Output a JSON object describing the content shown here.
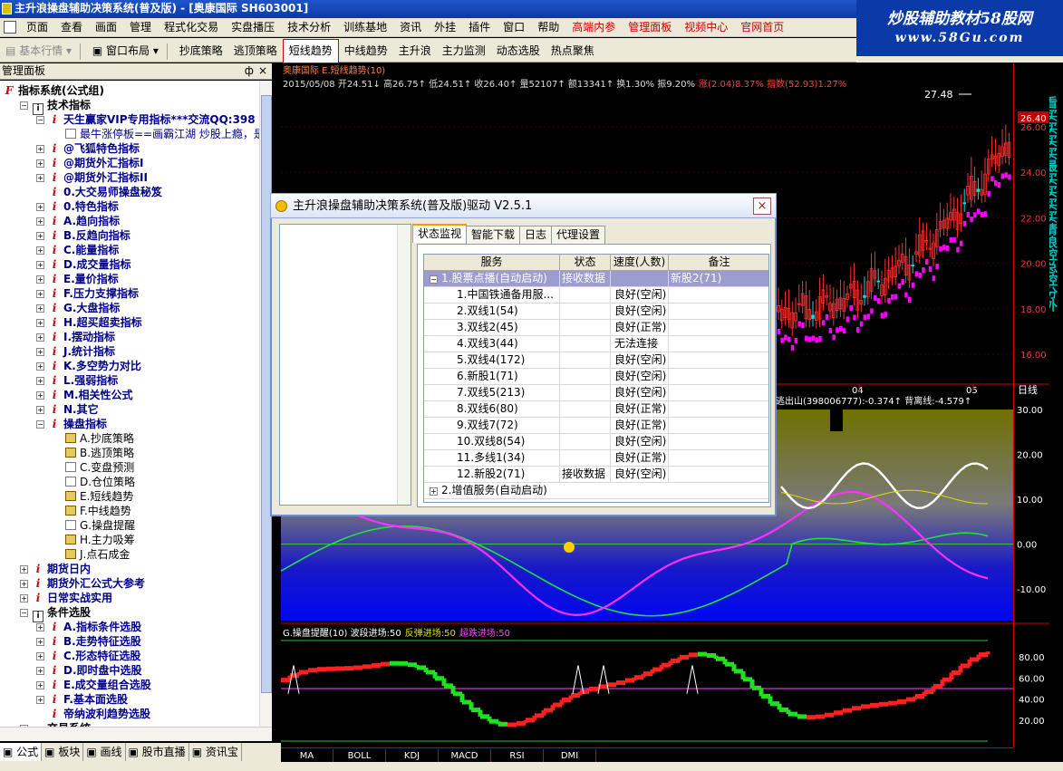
{
  "window": {
    "title": "主升浪操盘辅助决策系统(普及版) - [奥康国际 SH603001]"
  },
  "logo": {
    "line1": "炒股辅助教材58股网",
    "line2": "www.58Gu.com"
  },
  "menu": [
    "页面",
    "查看",
    "画面",
    "管理",
    "程式化交易",
    "实盘播压",
    "技术分析",
    "训练基地",
    "资讯",
    "外挂",
    "插件",
    "窗口",
    "帮助"
  ],
  "menu_red": [
    "高端内参",
    "管理面板",
    "视频中心",
    "官网首页"
  ],
  "toolbar": {
    "basic": "基本行情",
    "layout": "窗口布局",
    "items": [
      "抄底策略",
      "逃顶策略",
      "短线趋势",
      "中线趋势",
      "主升浪",
      "主力监测",
      "动态选股",
      "热点聚焦"
    ],
    "active": "短线趋势"
  },
  "panel": {
    "title": "管理面板",
    "pin": "ф",
    "close": "×"
  },
  "tree": [
    {
      "d": 0,
      "k": "f",
      "t": "指标系统(公式组)",
      "b": true
    },
    {
      "d": 1,
      "k": "pm-",
      "ic": "book",
      "t": "技术指标",
      "b": true
    },
    {
      "d": 2,
      "k": "pm-",
      "ic": "i",
      "t": "天生赢家VIP专用指标***交流QQ:398",
      "b": true,
      "c": "blue"
    },
    {
      "d": 3,
      "k": "",
      "ic": "chart",
      "t": "最牛涨停板==画霸江湖  炒股上瘾，是L",
      "c": "blue"
    },
    {
      "d": 2,
      "k": "pm+",
      "ic": "i",
      "t": "@飞狐特色指标",
      "b": true,
      "c": "blue"
    },
    {
      "d": 2,
      "k": "pm+",
      "ic": "i",
      "t": "@期货外汇指标I",
      "b": true,
      "c": "blue"
    },
    {
      "d": 2,
      "k": "pm+",
      "ic": "i",
      "t": "@期货外汇指标II",
      "b": true,
      "c": "blue"
    },
    {
      "d": 2,
      "k": "",
      "ic": "i",
      "t": "0.大交易师操盘秘笈",
      "b": true,
      "c": "blue"
    },
    {
      "d": 2,
      "k": "pm+",
      "ic": "i",
      "t": "0.特色指标",
      "b": true,
      "c": "blue"
    },
    {
      "d": 2,
      "k": "pm+",
      "ic": "i",
      "t": "A.趋向指标",
      "b": true,
      "c": "blue"
    },
    {
      "d": 2,
      "k": "pm+",
      "ic": "i",
      "t": "B.反趋向指标",
      "b": true,
      "c": "blue"
    },
    {
      "d": 2,
      "k": "pm+",
      "ic": "i",
      "t": "C.能量指标",
      "b": true,
      "c": "blue"
    },
    {
      "d": 2,
      "k": "pm+",
      "ic": "i",
      "t": "D.成交量指标",
      "b": true,
      "c": "blue"
    },
    {
      "d": 2,
      "k": "pm+",
      "ic": "i",
      "t": "E.量价指标",
      "b": true,
      "c": "blue"
    },
    {
      "d": 2,
      "k": "pm+",
      "ic": "i",
      "t": "F.压力支撑指标",
      "b": true,
      "c": "blue"
    },
    {
      "d": 2,
      "k": "pm+",
      "ic": "i",
      "t": "G.大盘指标",
      "b": true,
      "c": "blue"
    },
    {
      "d": 2,
      "k": "pm+",
      "ic": "i",
      "t": "H.超买超卖指标",
      "b": true,
      "c": "blue"
    },
    {
      "d": 2,
      "k": "pm+",
      "ic": "i",
      "t": "I.摆动指标",
      "b": true,
      "c": "blue"
    },
    {
      "d": 2,
      "k": "pm+",
      "ic": "i",
      "t": "J.统计指标",
      "b": true,
      "c": "blue"
    },
    {
      "d": 2,
      "k": "pm+",
      "ic": "i",
      "t": "K.多空势力对比",
      "b": true,
      "c": "blue"
    },
    {
      "d": 2,
      "k": "pm+",
      "ic": "i",
      "t": "L.强弱指标",
      "b": true,
      "c": "blue"
    },
    {
      "d": 2,
      "k": "pm+",
      "ic": "i",
      "t": "M.相关性公式",
      "b": true,
      "c": "blue"
    },
    {
      "d": 2,
      "k": "pm+",
      "ic": "i",
      "t": "N.其它",
      "b": true,
      "c": "blue"
    },
    {
      "d": 2,
      "k": "pm-",
      "ic": "i",
      "t": "操盘指标",
      "b": true,
      "c": "blue"
    },
    {
      "d": 3,
      "k": "",
      "ic": "y",
      "t": "A.抄底策略"
    },
    {
      "d": 3,
      "k": "",
      "ic": "y",
      "t": "B.逃顶策略"
    },
    {
      "d": 3,
      "k": "",
      "ic": "chart",
      "t": "C.变盘预测"
    },
    {
      "d": 3,
      "k": "",
      "ic": "chart",
      "t": "D.仓位策略"
    },
    {
      "d": 3,
      "k": "",
      "ic": "y",
      "t": "E.短线趋势"
    },
    {
      "d": 3,
      "k": "",
      "ic": "y",
      "t": "F.中线趋势"
    },
    {
      "d": 3,
      "k": "",
      "ic": "chart",
      "t": "G.操盘提醒"
    },
    {
      "d": 3,
      "k": "",
      "ic": "y",
      "t": "H.主力吸筹"
    },
    {
      "d": 3,
      "k": "",
      "ic": "y",
      "t": "J.点石成金"
    },
    {
      "d": 1,
      "k": "pm+",
      "ic": "i",
      "t": "期货日内",
      "b": true,
      "c": "blue"
    },
    {
      "d": 1,
      "k": "pm+",
      "ic": "i",
      "t": "期货外汇公式大参考",
      "b": true,
      "c": "blue"
    },
    {
      "d": 1,
      "k": "pm+",
      "ic": "i",
      "t": "日常实战实用",
      "b": true,
      "c": "blue"
    },
    {
      "d": 1,
      "k": "pm-",
      "ic": "book",
      "t": "条件选股",
      "b": true
    },
    {
      "d": 2,
      "k": "pm+",
      "ic": "i",
      "t": "A.指标条件选股",
      "b": true,
      "c": "blue"
    },
    {
      "d": 2,
      "k": "pm+",
      "ic": "i",
      "t": "B.走势特征选股",
      "b": true,
      "c": "blue"
    },
    {
      "d": 2,
      "k": "pm+",
      "ic": "i",
      "t": "C.形态特征选股",
      "b": true,
      "c": "blue"
    },
    {
      "d": 2,
      "k": "pm+",
      "ic": "i",
      "t": "D.即时盘中选股",
      "b": true,
      "c": "blue"
    },
    {
      "d": 2,
      "k": "pm+",
      "ic": "i",
      "t": "E.成交量组合选股",
      "b": true,
      "c": "blue"
    },
    {
      "d": 2,
      "k": "pm+",
      "ic": "i",
      "t": "F.基本面选股",
      "b": true,
      "c": "blue"
    },
    {
      "d": 2,
      "k": "",
      "ic": "i",
      "t": "帝纳波利趋势选股",
      "b": true,
      "c": "blue"
    },
    {
      "d": 1,
      "k": "pm+",
      "ic": "book",
      "t": "交易系统",
      "b": true
    }
  ],
  "bottom_tabs": [
    "公式",
    "板块",
    "画线",
    "股市直播",
    "资讯宝"
  ],
  "chart": {
    "header": "奥康国际 E.短线趋势(10)",
    "info": "2015/05/08  开24.51↓ 高26.75↑ 低24.51↑ 收26.40↑ 量52107↑ 额13341↑ 换1.30% 振9.20%",
    "info_red": "涨(2.04)8.37% 指数(52.93)1.27%",
    "peak_label": "27.48",
    "last_price": "26.40",
    "axis_main": [
      "26.00",
      "24.00",
      "22.00",
      "20.00",
      "18.00",
      "16.00"
    ],
    "date_labels": [
      "04",
      "05"
    ],
    "date_unit": "日线",
    "mid_legend": "逃出山(398006777):-0.374↑ 背离线:-4.579↑",
    "axis_mid": [
      "30.00",
      "20.00",
      "10.00",
      "0.00",
      "-10.00"
    ],
    "bottom_legend_a": "G.操盘提醒(10) 波段进场:50",
    "bottom_legend_b": "反弹进场:50",
    "bottom_legend_c": "超跌进场:50",
    "axis_bottom": [
      "80.00",
      "60.00",
      "40.00",
      "20.00"
    ],
    "tabs": [
      "MA",
      "BOLL",
      "KDJ",
      "MACD",
      "RSI",
      "DMI"
    ],
    "right_strip": "看买买买买最买买买买清浪控总控分外",
    "right_edge_nums": [
      "14",
      "14",
      "14",
      "14",
      "14",
      "14",
      "14",
      "14",
      "14",
      "15"
    ]
  },
  "dialog": {
    "title": "主升浪操盘辅助决策系统(普及版)驱动 V2.5.1",
    "close": "×",
    "tabs": [
      "状态监视",
      "智能下载",
      "日志",
      "代理设置"
    ],
    "columns": [
      "服务",
      "状态",
      "速度(人数)",
      "备注"
    ],
    "group1": {
      "name": "1.股票点播(自动启动)",
      "status": "接收数据",
      "note": "新股2(71)"
    },
    "rows": [
      {
        "name": "1.中国铁通备用服...",
        "status": "",
        "speed": "良好(空闲)",
        "note": ""
      },
      {
        "name": "2.双线1(54)",
        "status": "",
        "speed": "良好(空闲)",
        "note": ""
      },
      {
        "name": "3.双线2(45)",
        "status": "",
        "speed": "良好(正常)",
        "note": ""
      },
      {
        "name": "4.双线3(44)",
        "status": "",
        "speed": "无法连接",
        "note": ""
      },
      {
        "name": "5.双线4(172)",
        "status": "",
        "speed": "良好(空闲)",
        "note": ""
      },
      {
        "name": "6.新股1(71)",
        "status": "",
        "speed": "良好(空闲)",
        "note": ""
      },
      {
        "name": "7.双线5(213)",
        "status": "",
        "speed": "良好(空闲)",
        "note": ""
      },
      {
        "name": "8.双线6(80)",
        "status": "",
        "speed": "良好(正常)",
        "note": ""
      },
      {
        "name": "9.双线7(72)",
        "status": "",
        "speed": "良好(正常)",
        "note": ""
      },
      {
        "name": "10.双线8(54)",
        "status": "",
        "speed": "良好(空闲)",
        "note": ""
      },
      {
        "name": "11.多线1(34)",
        "status": "",
        "speed": "良好(正常)",
        "note": ""
      },
      {
        "name": "12.新股2(71)",
        "status": "接收数据",
        "speed": "良好(空闲)",
        "note": ""
      }
    ],
    "group2": {
      "name": "2.增值服务(自动启动)"
    }
  }
}
